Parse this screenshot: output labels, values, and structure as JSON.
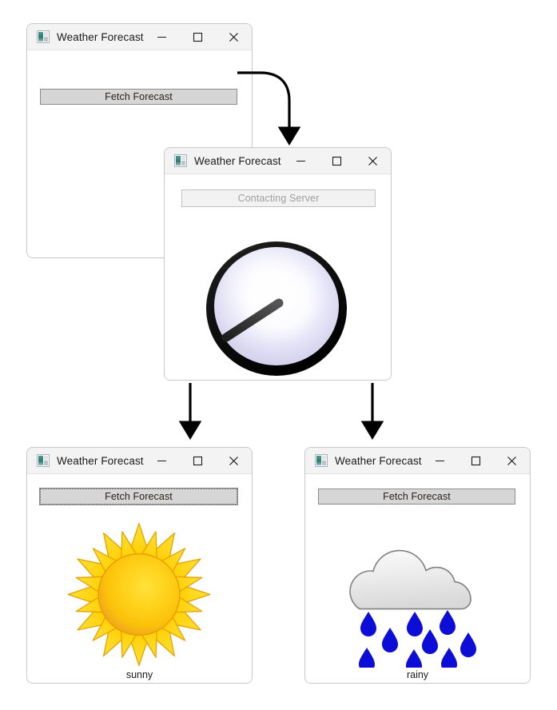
{
  "diagram": {
    "title": "Weather Forecast application state flow",
    "arrows": [
      {
        "name": "arrow-start-to-busy",
        "kind": "curved",
        "from": "fetch-forecast-button",
        "to": "busy-window"
      },
      {
        "name": "arrow-busy-to-sunny",
        "kind": "straight-down",
        "from": "busy-window",
        "to": "sunny-window"
      },
      {
        "name": "arrow-busy-to-rainy",
        "kind": "straight-down",
        "from": "busy-window",
        "to": "rainy-window"
      }
    ]
  },
  "colors": {
    "titlebar_bg": "#f3f3f3",
    "window_border": "#c8c8c8",
    "button_bg": "#d6d6d6",
    "button_border": "#8c8c8c",
    "button_disabled_text": "#a0a0a0",
    "arrow": "#000000",
    "sun_core": "#ffcc00",
    "sun_outline": "#e8a000",
    "cloud_fill": "#ececec",
    "cloud_outline": "#808080",
    "raindrop": "#0d0dd8",
    "clock_ring": "#101010",
    "clock_face": "#e3e2f6",
    "clock_hand": "#3c3c3c"
  },
  "icons": {
    "app": "app-window-icon",
    "minimize": "minimize-icon",
    "maximize": "maximize-icon",
    "close": "close-icon"
  },
  "windows": {
    "start": {
      "name": "start-window",
      "title": "Weather Forecast",
      "button_label": "Fetch Forecast",
      "button_state": "enabled",
      "status": ""
    },
    "busy": {
      "name": "busy-window",
      "title": "Weather Forecast",
      "button_label": "Contacting Server",
      "button_state": "disabled",
      "art": "clock-busy-icon",
      "status": ""
    },
    "sunny": {
      "name": "sunny-window",
      "title": "Weather Forecast",
      "button_label": "Fetch Forecast",
      "button_state": "focused",
      "art": "sun-icon",
      "status": "sunny"
    },
    "rainy": {
      "name": "rainy-window",
      "title": "Weather Forecast",
      "button_label": "Fetch Forecast",
      "button_state": "enabled",
      "art": "rain-cloud-icon",
      "status": "rainy"
    }
  }
}
